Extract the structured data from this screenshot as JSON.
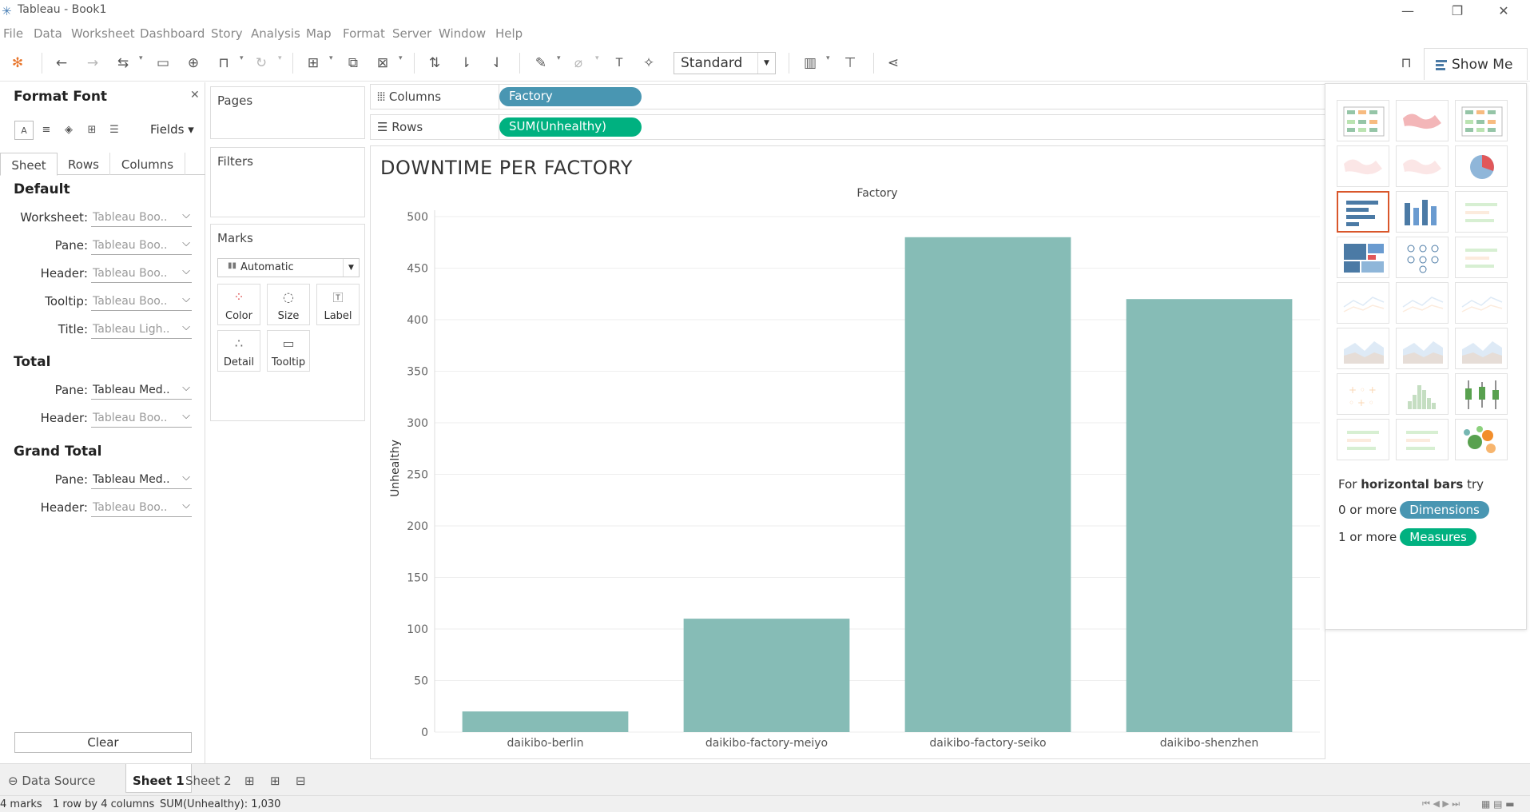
{
  "window": {
    "title": "Tableau - Book1",
    "minimize_icon": "minimize-icon",
    "maximize_icon": "restore-icon",
    "close_icon": "close-icon"
  },
  "menu": [
    "File",
    "Data",
    "Worksheet",
    "Dashboard",
    "Story",
    "Analysis",
    "Map",
    "Format",
    "Server",
    "Window",
    "Help"
  ],
  "toolbar": {
    "fit_value": "Standard",
    "show_me_label": "Show Me"
  },
  "format_pane": {
    "title": "Format Font",
    "fields_label": "Fields",
    "tabs": [
      "Sheet",
      "Rows",
      "Columns"
    ],
    "sections": [
      {
        "title": "Default",
        "rows": [
          {
            "label": "Worksheet:",
            "value": "Tableau Boo.."
          },
          {
            "label": "Pane:",
            "value": "Tableau Boo.."
          },
          {
            "label": "Header:",
            "value": "Tableau Boo.."
          },
          {
            "label": "Tooltip:",
            "value": "Tableau Boo.."
          },
          {
            "label": "Title:",
            "value": "Tableau Ligh.."
          }
        ]
      },
      {
        "title": "Total",
        "rows": [
          {
            "label": "Pane:",
            "value": "Tableau Med.."
          },
          {
            "label": "Header:",
            "value": "Tableau Boo.."
          }
        ]
      },
      {
        "title": "Grand Total",
        "rows": [
          {
            "label": "Pane:",
            "value": "Tableau Med.."
          },
          {
            "label": "Header:",
            "value": "Tableau Boo.."
          }
        ]
      }
    ],
    "clear_label": "Clear"
  },
  "cards": {
    "pages": "Pages",
    "filters": "Filters",
    "marks": "Marks",
    "marks_type": "Automatic",
    "mark_buttons": [
      "Color",
      "Size",
      "Label",
      "Detail",
      "Tooltip"
    ]
  },
  "shelves": {
    "columns_label": "Columns",
    "columns_pill": "Factory",
    "rows_label": "Rows",
    "rows_pill": "SUM(Unhealthy)"
  },
  "colors": {
    "dimension": "#4996b2",
    "measure": "#00b180",
    "bar": "#86bcb6",
    "selected_border": "#d9572b"
  },
  "chart_data": {
    "type": "bar",
    "title": "DOWNTIME PER FACTORY",
    "header": "Factory",
    "ylabel": "Unhealthy",
    "categories": [
      "daikibo-berlin",
      "daikibo-factory-meiyo",
      "daikibo-factory-seiko",
      "daikibo-shenzhen"
    ],
    "values": [
      20,
      110,
      480,
      420
    ],
    "ylim": [
      0,
      500
    ],
    "yticks": [
      0,
      50,
      100,
      150,
      200,
      250,
      300,
      350,
      400,
      450,
      500
    ],
    "grid": true,
    "bar_color": "#86bcb6"
  },
  "show_me": {
    "hint_prefix": "For ",
    "hint_bold": "horizontal bars",
    "hint_suffix": " try",
    "dimensions_prefix": "0 or more",
    "dimensions_label": "Dimensions",
    "measures_prefix": "1 or more",
    "measures_label": "Measures"
  },
  "sheet_tabs": {
    "data_source": "Data Source",
    "sheets": [
      "Sheet 1",
      "Sheet 2"
    ]
  },
  "status": {
    "marks": "4 marks",
    "dims": "1 row by 4 columns",
    "sum": "SUM(Unhealthy): 1,030"
  }
}
